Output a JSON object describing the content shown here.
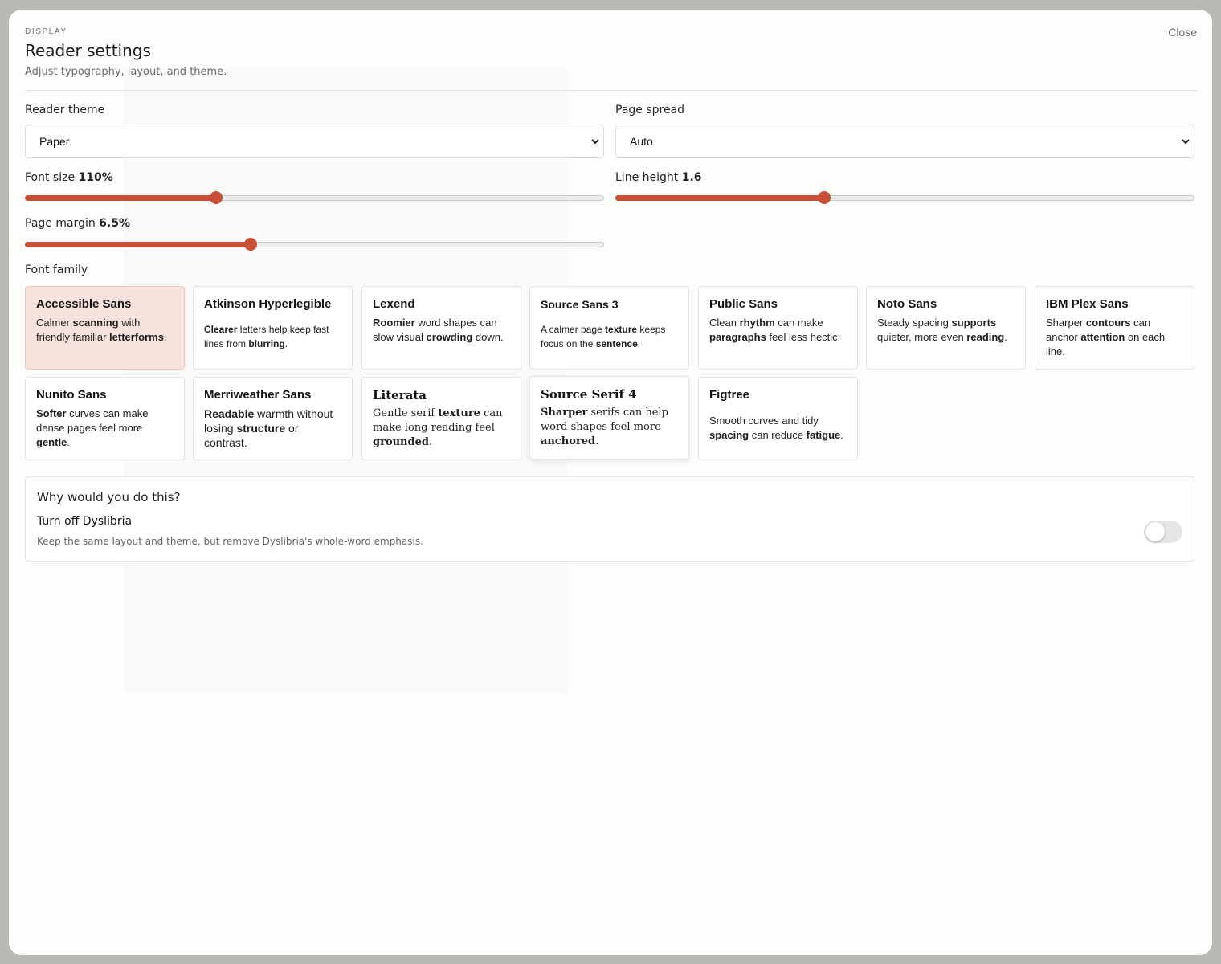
{
  "header": {
    "eyebrow": "DISPLAY",
    "title": "Reader settings",
    "subtitle": "Adjust typography, layout, and theme.",
    "close_label": "Close"
  },
  "theme": {
    "label": "Reader theme",
    "value": "Paper"
  },
  "spread": {
    "label": "Page spread",
    "value": "Auto"
  },
  "font_size": {
    "label": "Font size",
    "value_text": "110%",
    "fraction": 0.33
  },
  "line_height": {
    "label": "Line height",
    "value_text": "1.6",
    "fraction": 0.36
  },
  "page_margin": {
    "label": "Page margin",
    "value_text": "6.5%",
    "fraction": 0.39
  },
  "font_family": {
    "label": "Font family",
    "selected": "Accessible Sans",
    "cards": [
      {
        "name": "Accessible Sans",
        "parts": [
          [
            "Calmer ",
            false
          ],
          [
            "scanning",
            true
          ],
          [
            " with friendly familiar ",
            false
          ],
          [
            "letterforms",
            true
          ],
          [
            ".",
            false
          ]
        ]
      },
      {
        "name": "Atkinson Hyperlegible",
        "parts": [
          [
            "Clearer",
            true
          ],
          [
            " letters help keep fast lines from ",
            false
          ],
          [
            "blurring",
            true
          ],
          [
            ".",
            false
          ]
        ]
      },
      {
        "name": "Lexend",
        "parts": [
          [
            "Roomier",
            true
          ],
          [
            " word shapes can slow visual ",
            false
          ],
          [
            "crowding",
            true
          ],
          [
            " down.",
            false
          ]
        ]
      },
      {
        "name": "Source Sans 3",
        "parts": [
          [
            "A calmer page ",
            false
          ],
          [
            "texture",
            true
          ],
          [
            " keeps focus on the ",
            false
          ],
          [
            "sentence",
            true
          ],
          [
            ".",
            false
          ]
        ]
      },
      {
        "name": "Public Sans",
        "parts": [
          [
            "Clean ",
            false
          ],
          [
            "rhythm",
            true
          ],
          [
            " can make ",
            false
          ],
          [
            "paragraphs",
            true
          ],
          [
            " feel less hectic.",
            false
          ]
        ]
      },
      {
        "name": "Noto Sans",
        "parts": [
          [
            "Steady spacing ",
            false
          ],
          [
            "supports",
            true
          ],
          [
            " quieter, more even ",
            false
          ],
          [
            "reading",
            true
          ],
          [
            ".",
            false
          ]
        ]
      },
      {
        "name": "IBM Plex Sans",
        "parts": [
          [
            "Sharper ",
            false
          ],
          [
            "contours",
            true
          ],
          [
            " can anchor ",
            false
          ],
          [
            "attention",
            true
          ],
          [
            " on each line.",
            false
          ]
        ]
      },
      {
        "name": "Nunito Sans",
        "parts": [
          [
            "Softer",
            true
          ],
          [
            " curves can make dense pages feel more ",
            false
          ],
          [
            "gentle",
            true
          ],
          [
            ".",
            false
          ]
        ]
      },
      {
        "name": "Merriweather Sans",
        "parts": [
          [
            "Readable",
            true
          ],
          [
            " warmth without losing ",
            false
          ],
          [
            "structure",
            true
          ],
          [
            " or contrast.",
            false
          ]
        ]
      },
      {
        "name": "Literata",
        "parts": [
          [
            "Gentle serif ",
            false
          ],
          [
            "texture",
            true
          ],
          [
            " can make long reading feel ",
            false
          ],
          [
            "grounded",
            true
          ],
          [
            ".",
            false
          ]
        ]
      },
      {
        "name": "Source Serif 4",
        "parts": [
          [
            "Sharper",
            true
          ],
          [
            " serifs can help word shapes feel more ",
            false
          ],
          [
            "anchored",
            true
          ],
          [
            ".",
            false
          ]
        ]
      },
      {
        "name": "Figtree",
        "parts": [
          [
            "Smooth curves and tidy ",
            false
          ],
          [
            "spacing",
            true
          ],
          [
            " can reduce ",
            false
          ],
          [
            "fatigue",
            true
          ],
          [
            ".",
            false
          ]
        ]
      }
    ]
  },
  "why": {
    "question": "Why would you do this?",
    "title": "Turn off Dyslibria",
    "description": "Keep the same layout and theme, but remove Dyslibria's whole-word emphasis.",
    "toggle_on": false
  },
  "colors": {
    "accent": "#c84f36",
    "selected_card": "#f6e2dc"
  }
}
